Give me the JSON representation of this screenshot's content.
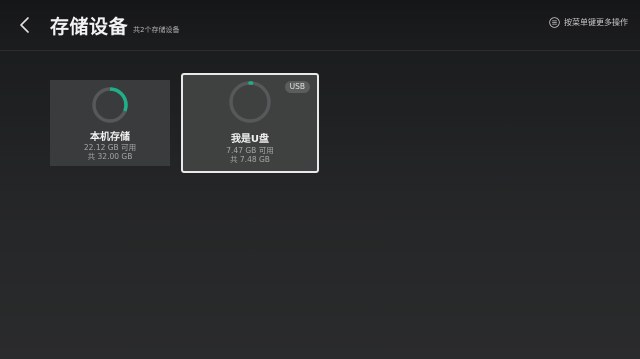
{
  "header": {
    "title": "存储设备",
    "subtitle": "共2个存储设备",
    "menu_hint": "按菜单键更多操作",
    "back_icon": "chevron-left-icon",
    "menu_icon": "menu-circle-icon"
  },
  "colors": {
    "accent": "#1fb08a",
    "ring_track": "#575859",
    "focus_border": "#e9e9e9"
  },
  "storage": {
    "local": {
      "name": "本机存储",
      "available": "22.12 GB 可用",
      "total": "共 32.00 GB",
      "used_fraction": 0.31
    },
    "usb": {
      "name": "我是U盘",
      "available": "7.47 GB 可用",
      "total": "共 7.48 GB",
      "badge": "USB",
      "used_fraction": 0.01
    }
  }
}
